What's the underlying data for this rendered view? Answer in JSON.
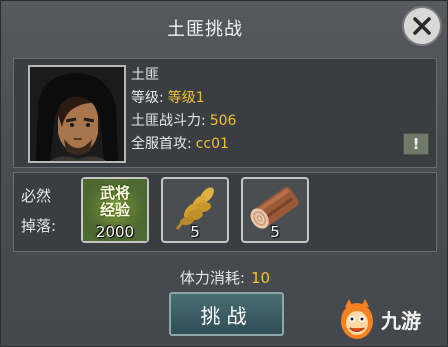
{
  "dialog": {
    "title": "土匪挑战",
    "close_icon": "close-icon"
  },
  "enemy": {
    "name": "土匪",
    "level_label": "等级:",
    "level_value": "等级1",
    "power_label": "土匪战斗力:",
    "power_value": "506",
    "first_kill_label": "全服首攻:",
    "first_kill_value": "cc01",
    "alert_symbol": "!"
  },
  "drops": {
    "label_line1": "必然",
    "label_line2": "掉落:",
    "items": [
      {
        "icon": "general-exp-book-icon",
        "title_line1": "武将",
        "title_line2": "经验",
        "count": "2000"
      },
      {
        "icon": "wheat-icon",
        "count": "5"
      },
      {
        "icon": "wood-log-icon",
        "count": "5"
      }
    ]
  },
  "stamina": {
    "label": "体力消耗:",
    "value": "10"
  },
  "challenge_button": "挑战",
  "watermark": {
    "text": "九游"
  },
  "colors": {
    "accent_value": "#f0c030",
    "panel_bg": "#3a3e42",
    "button_bg": "#2f4e56"
  }
}
